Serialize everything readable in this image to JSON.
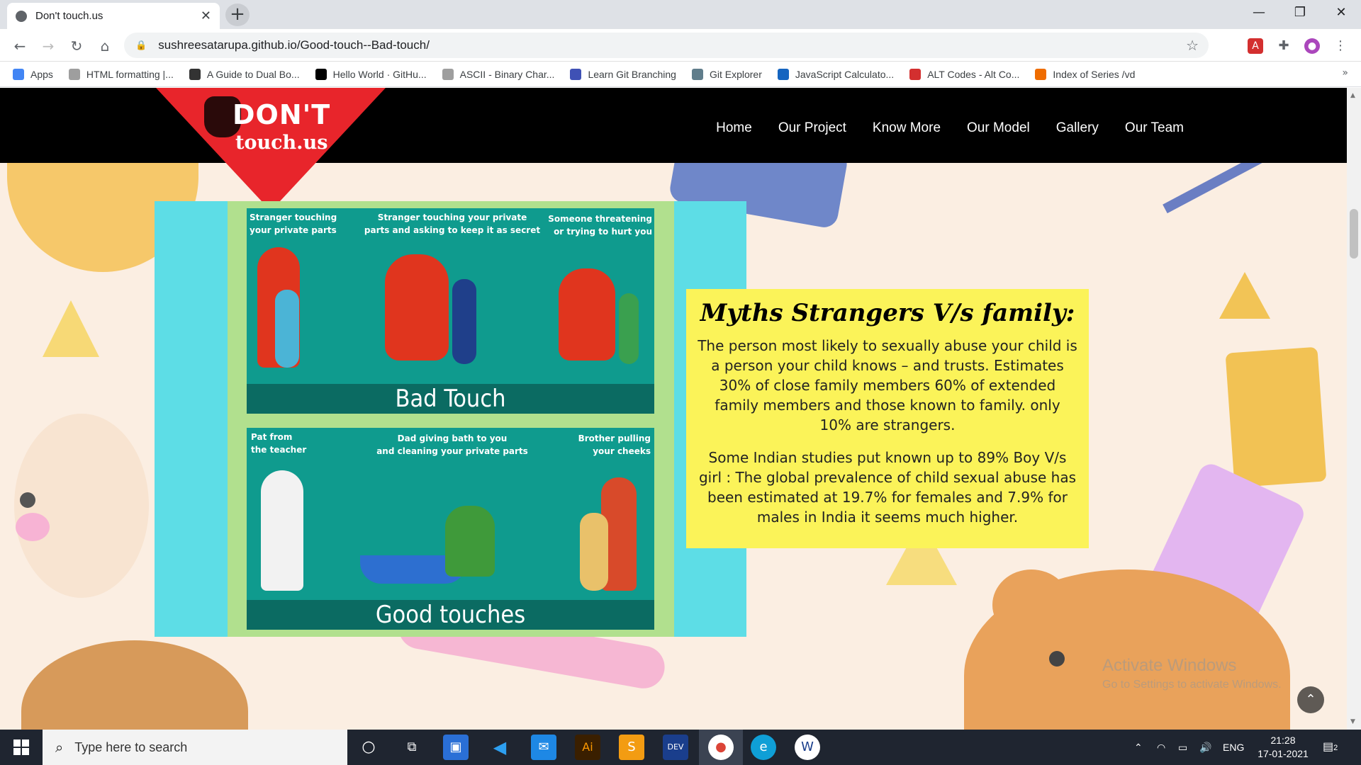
{
  "browser": {
    "tab_title": "Don't touch.us",
    "url": "sushreesatarupa.github.io/Good-touch--Bad-touch/",
    "bookmarks": [
      {
        "label": "Apps",
        "color": "#4285f4"
      },
      {
        "label": "HTML formatting |...",
        "color": "#9e9e9e"
      },
      {
        "label": "A Guide to Dual Bo...",
        "color": "#333333"
      },
      {
        "label": "Hello World · GitHu...",
        "color": "#000000"
      },
      {
        "label": "ASCII - Binary Char...",
        "color": "#9e9e9e"
      },
      {
        "label": "Learn Git Branching",
        "color": "#3f51b5"
      },
      {
        "label": "Git Explorer",
        "color": "#607d8b"
      },
      {
        "label": "JavaScript Calculato...",
        "color": "#1565c0"
      },
      {
        "label": "ALT Codes - Alt Co...",
        "color": "#d32f2f"
      },
      {
        "label": "Index of Series /vd",
        "color": "#ef6c00"
      }
    ]
  },
  "site": {
    "logo_line1": "DON'T",
    "logo_line2": "touch.us",
    "nav": [
      "Home",
      "Our Project",
      "Know More",
      "Our Model",
      "Gallery",
      "Our Team"
    ]
  },
  "illustration": {
    "bad_panel": {
      "captions": [
        "Stranger touching\nyour private parts",
        "Stranger touching your private\nparts and asking to keep it as secret",
        "Someone threatening\nor trying to hurt you"
      ],
      "title": "Bad Touch"
    },
    "good_panel": {
      "captions": [
        "Pat from\nthe teacher",
        "Dad giving bath to you\nand cleaning your private parts",
        "Brother pulling\nyour cheeks"
      ],
      "title": "Good touches"
    }
  },
  "myth": {
    "heading": "Myths Strangers V/s family:",
    "para1": "The person most likely to sexually abuse your child is a person your child knows – and trusts. Estimates 30% of close family members 60% of extended family members and those known to family. only 10% are strangers.",
    "para2": "Some Indian studies put known up to 89% Boy V/s girl : The global prevalence of child sexual abuse has been estimated at 19.7% for females and 7.9% for males in India it seems much higher."
  },
  "watermark": {
    "line1": "Activate Windows",
    "line2": "Go to Settings to activate Windows."
  },
  "taskbar": {
    "search_placeholder": "Type here to search",
    "language": "ENG",
    "time": "21:28",
    "date": "17-01-2021",
    "notification_count": "2"
  }
}
